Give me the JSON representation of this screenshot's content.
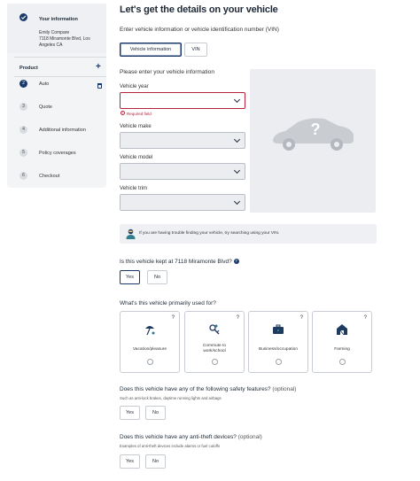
{
  "sidebar": {
    "your_information": {
      "title": "Your information",
      "name": "Emily Compare",
      "address_line1": "7118 Miramonte Blvd, Los",
      "address_line2": "Angeles CA"
    },
    "product_label": "Product",
    "add_symbol": "+",
    "steps": [
      {
        "num": "2",
        "label": "Auto"
      },
      {
        "num": "3",
        "label": "Quote"
      },
      {
        "num": "4",
        "label": "Additional information"
      },
      {
        "num": "5",
        "label": "Policy coverages"
      },
      {
        "num": "6",
        "label": "Checkout"
      }
    ]
  },
  "main": {
    "title": "Let's get the details on your vehicle",
    "intro": "Enter vehicle information or vehicle identification number (VIN)",
    "tabs": {
      "vehicle_info": "Vehicle information",
      "vin": "VIN"
    },
    "please": "Please enter your vehicle information",
    "fields": {
      "year": "Vehicle year",
      "make": "Vehicle make",
      "model": "Vehicle model",
      "trim": "Vehicle trim"
    },
    "required_error": "Required field",
    "help_text": "If you are having trouble finding your vehicle, try searching using your VIN.",
    "kept_question": "Is this vehicle kept at 7118 Miramonte Blvd?",
    "help_glyph": "?",
    "yes": "Yes",
    "no": "No",
    "use_question": "What's this vehicle primarily used for?",
    "use_options": [
      {
        "label": "Vacation/pleasure",
        "icon": "beach-umbrella-icon"
      },
      {
        "label": "Commute to work/school",
        "label1": "Commute to",
        "label2": "work/school",
        "icon": "keys-icon"
      },
      {
        "label": "Business/occupation",
        "icon": "briefcase-icon"
      },
      {
        "label": "Farming",
        "icon": "barn-icon"
      }
    ],
    "safety_question": "Does this vehicle have any of the following safety features?",
    "safety_optional": "(optional)",
    "safety_sub": "Such as anti-lock brakes, daytime running lights and airbags",
    "theft_question": "Does this vehicle have any anti-theft devices?",
    "theft_optional": "(optional)",
    "theft_sub": "Examples of anti-theft devices include alarms or fuel cutoffs"
  },
  "colors": {
    "accent": "#1b3a6b",
    "error": "#b5223a",
    "panel": "#ebedf0"
  }
}
